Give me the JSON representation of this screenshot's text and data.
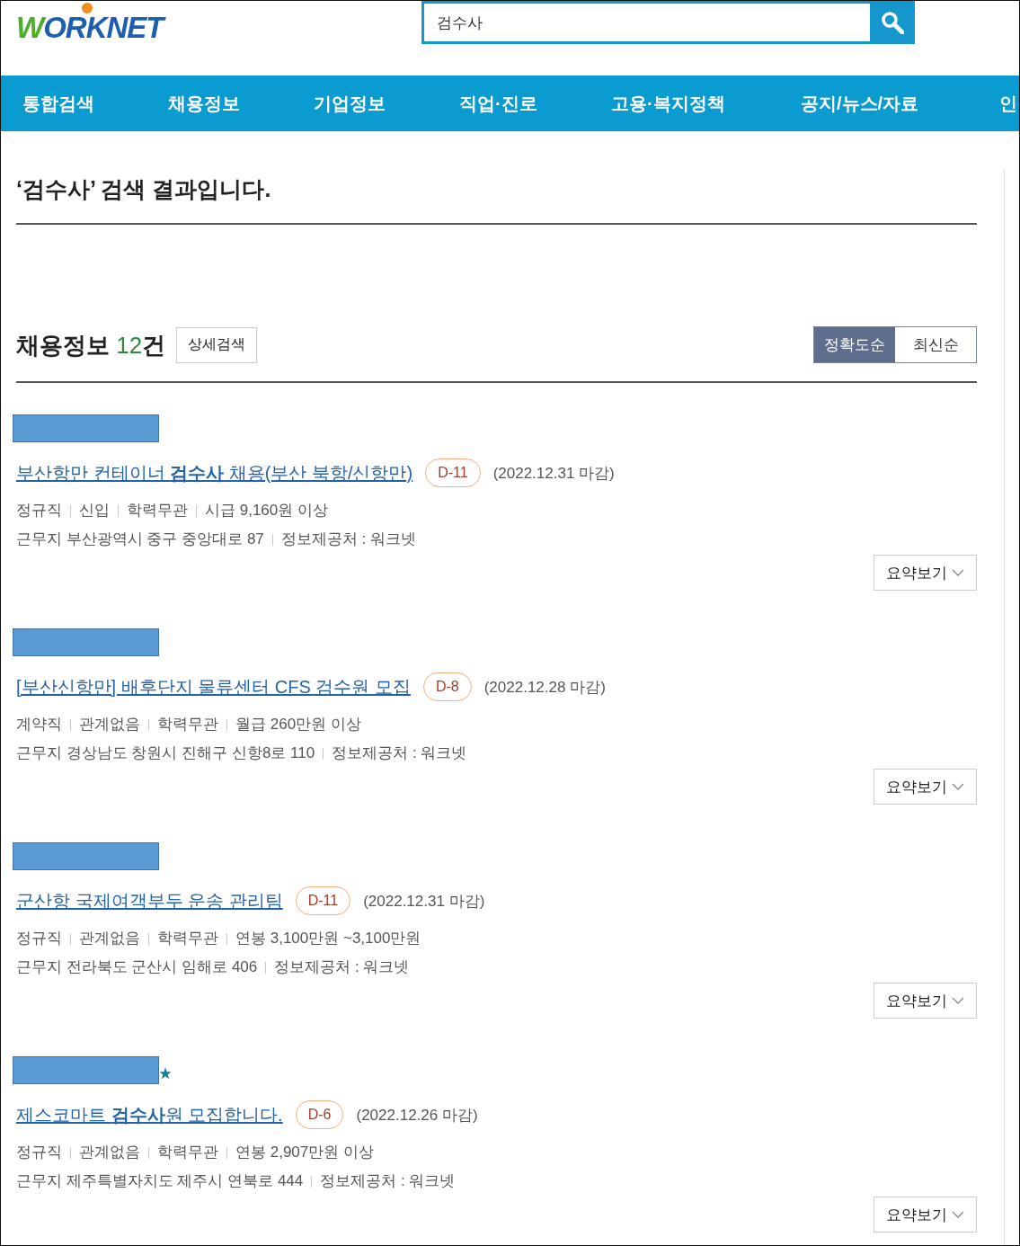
{
  "header": {
    "logo": "WORKNET",
    "search": {
      "value": "검수사"
    }
  },
  "nav": [
    {
      "label": "통합검색"
    },
    {
      "label": "채용정보"
    },
    {
      "label": "기업정보"
    },
    {
      "label": "직업·진로"
    },
    {
      "label": "고용·복지정책"
    },
    {
      "label": "공지/뉴스/자료"
    },
    {
      "label": "인"
    }
  ],
  "result_heading": "‘검수사’ 검색 결과입니다.",
  "section": {
    "title": "채용정보",
    "count": "12",
    "unit": "건",
    "detail_button": "상세검색",
    "sort": [
      {
        "label": "정확도순",
        "selected": true
      },
      {
        "label": "최신순",
        "selected": false
      }
    ]
  },
  "jobs": [
    {
      "starred": false,
      "title": "부산항만 컨테이너 **검수사** 채용(부산 북항/신항만)",
      "dday": "D-11",
      "deadline": "(2022.12.31 마감)",
      "conditions": [
        "정규직",
        "신입",
        "학력무관",
        "시급 9,160원 이상"
      ],
      "details": [
        "근무지 부산광역시 중구 중앙대로 87",
        "정보제공처 : 워크넷"
      ],
      "summary_button": "요약보기"
    },
    {
      "starred": false,
      "title": "[부산신항만] 배후단지 물류센터 CFS 검수원 모집",
      "dday": "D-8",
      "deadline": "(2022.12.28 마감)",
      "conditions": [
        "계약직",
        "관계없음",
        "학력무관",
        "월급 260만원 이상"
      ],
      "details": [
        "근무지 경상남도 창원시 진해구 신항8로 110",
        "정보제공처 : 워크넷"
      ],
      "summary_button": "요약보기"
    },
    {
      "starred": false,
      "title": "군산항 국제여객부두 운송 관리팀",
      "dday": "D-11",
      "deadline": "(2022.12.31 마감)",
      "conditions": [
        "정규직",
        "관계없음",
        "학력무관",
        "연봉 3,100만원 ~3,100만원"
      ],
      "details": [
        "근무지 전라북도 군산시 임해로 406",
        "정보제공처 : 워크넷"
      ],
      "summary_button": "요약보기"
    },
    {
      "starred": true,
      "title": "제스코마트 **검수사**원 모집합니다.",
      "dday": "D-6",
      "deadline": "(2022.12.26 마감)",
      "conditions": [
        "정규직",
        "관계없음",
        "학력무관",
        "연봉 2,907만원 이상"
      ],
      "details": [
        "근무지 제주특별자치도 제주시 연북로 444",
        "정보제공처 : 워크넷"
      ],
      "summary_button": "요약보기"
    }
  ]
}
